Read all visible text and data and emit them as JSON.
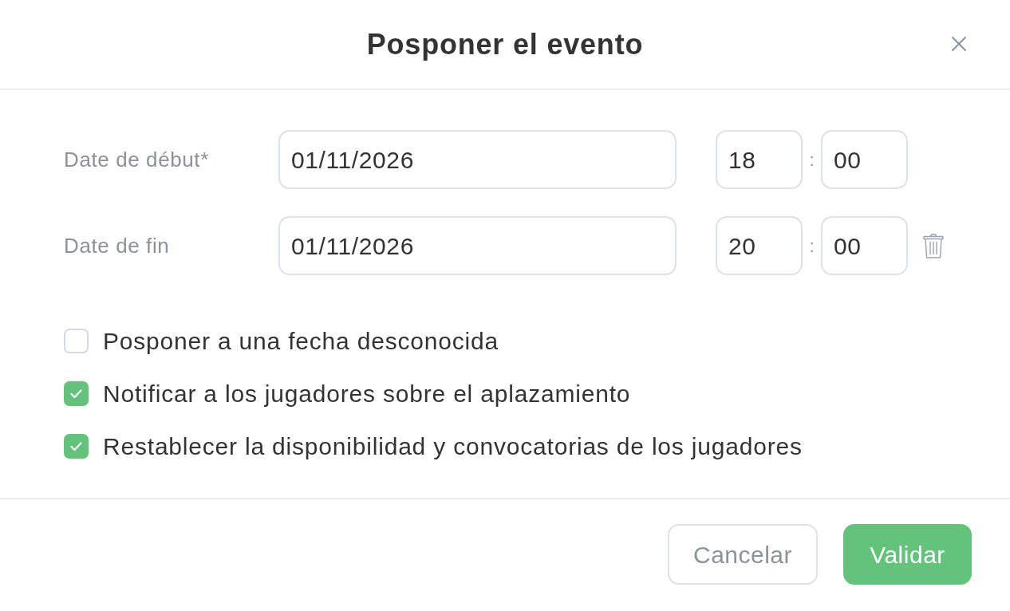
{
  "dialog": {
    "title": "Posponer el evento"
  },
  "fields": [
    {
      "label": "Date de début*",
      "date": "01/11/2026",
      "hour": "18",
      "separator": ":",
      "minute": "00",
      "deletable": false
    },
    {
      "label": "Date de fin",
      "date": "01/11/2026",
      "hour": "20",
      "separator": ":",
      "minute": "00",
      "deletable": true
    }
  ],
  "options": [
    {
      "label": "Posponer a una fecha desconocida",
      "checked": false
    },
    {
      "label": "Notificar a los jugadores sobre el aplazamiento",
      "checked": true
    },
    {
      "label": "Restablecer la disponibilidad y convocatorias de los jugadores",
      "checked": true
    }
  ],
  "buttons": [
    {
      "label": "Cancelar",
      "kind": "secondary"
    },
    {
      "label": "Validar",
      "kind": "primary"
    }
  ]
}
